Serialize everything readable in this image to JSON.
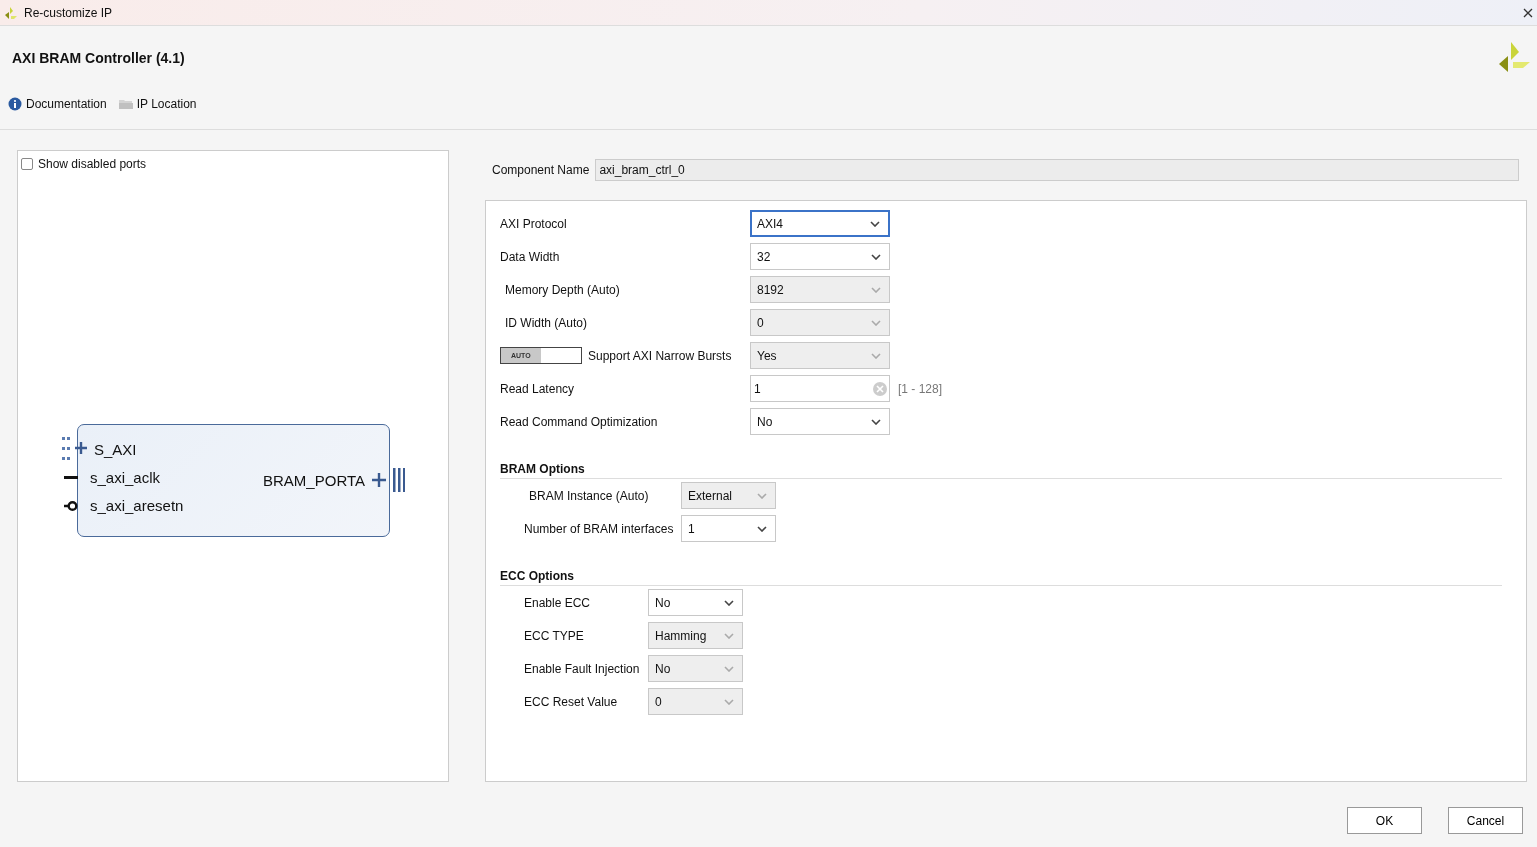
{
  "window": {
    "title": "Re-customize IP"
  },
  "header": {
    "title": "AXI BRAM Controller (4.1)",
    "links": [
      {
        "kind": "info",
        "label": "Documentation"
      },
      {
        "kind": "folder",
        "label": "IP Location"
      }
    ]
  },
  "symbol_panel": {
    "show_disabled_ports": {
      "label": "Show disabled ports",
      "checked": false
    },
    "block": {
      "left_pins": [
        {
          "kind": "bus",
          "name": "S_AXI"
        },
        {
          "kind": "clock",
          "name": "s_axi_aclk"
        },
        {
          "kind": "reset",
          "name": "s_axi_aresetn"
        }
      ],
      "right_pins": [
        {
          "kind": "bus",
          "name": "BRAM_PORTA"
        }
      ]
    }
  },
  "component_name": {
    "label": "Component Name",
    "value": "axi_bram_ctrl_0"
  },
  "parameters": [
    {
      "kind": "dropdown",
      "label": "AXI Protocol",
      "value": "AXI4",
      "disabled": false,
      "focused": true
    },
    {
      "kind": "dropdown",
      "label": "Data Width",
      "value": "32",
      "disabled": false,
      "focused": false
    },
    {
      "kind": "dropdown",
      "label": "Memory Depth (Auto)",
      "value": "8192",
      "disabled": true,
      "focused": false
    },
    {
      "kind": "dropdown",
      "label": "ID Width (Auto)",
      "value": "0",
      "disabled": true,
      "focused": false
    },
    {
      "kind": "auto-dropdown",
      "toggle": {
        "label": "AUTO",
        "on": true
      },
      "label": "Support AXI Narrow Bursts",
      "value": "Yes",
      "disabled": true,
      "focused": false
    },
    {
      "kind": "text",
      "label": "Read Latency",
      "value": "1",
      "range": "[1 - 128]",
      "disabled": false,
      "focused": false
    },
    {
      "kind": "dropdown",
      "label": "Read Command Optimization",
      "value": "No",
      "disabled": false,
      "focused": false
    }
  ],
  "sections": [
    {
      "title": "BRAM Options",
      "fields": [
        {
          "label": "BRAM Instance (Auto)",
          "value": "External",
          "disabled": true
        },
        {
          "label": "Number of BRAM interfaces",
          "value": "1",
          "disabled": false
        }
      ]
    },
    {
      "title": "ECC Options",
      "fields": [
        {
          "label": "Enable ECC",
          "value": "No",
          "disabled": false
        },
        {
          "label": "ECC TYPE",
          "value": "Hamming",
          "disabled": true
        },
        {
          "label": "Enable Fault Injection",
          "value": "No",
          "disabled": true
        },
        {
          "label": "ECC Reset Value",
          "value": "0",
          "disabled": true
        }
      ]
    }
  ],
  "buttons": [
    "OK",
    "Cancel"
  ]
}
